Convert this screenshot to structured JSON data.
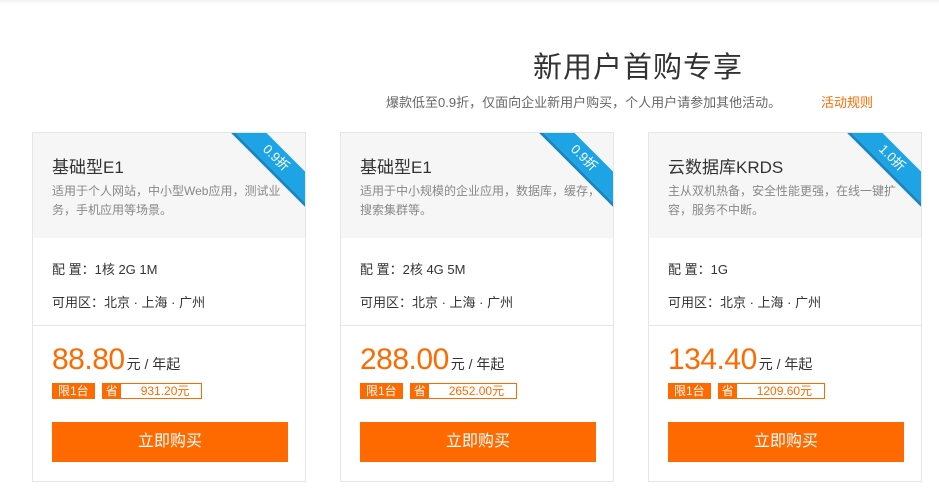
{
  "header": {
    "title": "新用户首购专享",
    "subtitle": "爆款低至0.9折，仅面向企业新用户购买，个人用户请参加其他活动。",
    "rules_link": "活动规则"
  },
  "colors": {
    "accent": "#ff6a00",
    "ribbon": "#1ea4e4"
  },
  "cards": [
    {
      "name": "基础型E1",
      "description": "适用于个人网站，中小型Web应用，测试业务，手机应用等场景。",
      "discount": "0.9折",
      "config": "配 置：1核 2G 1M",
      "zones": "可用区：北京 · 上海 · 广州",
      "price": "88.80",
      "price_unit": "元 / 年起",
      "limit_tag": "限1台",
      "save_label": "省",
      "save_amount": "931.20元",
      "buy_label": "立即购买"
    },
    {
      "name": "基础型E1",
      "description": "适用于中小规模的企业应用，数据库，缓存，搜索集群等。",
      "discount": "0.9折",
      "config": "配 置：2核 4G 5M",
      "zones": "可用区：北京 · 上海 · 广州",
      "price": "288.00",
      "price_unit": "元 / 年起",
      "limit_tag": "限1台",
      "save_label": "省",
      "save_amount": "2652.00元",
      "buy_label": "立即购买"
    },
    {
      "name": "云数据库KRDS",
      "description": "主从双机热备，安全性能更强，在线一键扩容，服务不中断。",
      "discount": "1.0折",
      "config": "配 置：1G",
      "zones": "可用区：北京 · 上海 · 广州",
      "price": "134.40",
      "price_unit": "元 / 年起",
      "limit_tag": "限1台",
      "save_label": "省",
      "save_amount": "1209.60元",
      "buy_label": "立即购买"
    }
  ]
}
